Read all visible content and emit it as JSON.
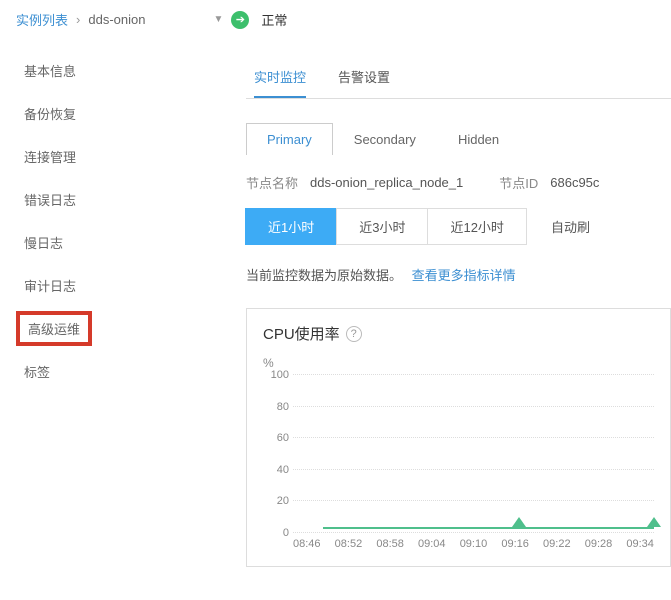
{
  "breadcrumb": {
    "list_label": "实例列表",
    "instance": "dds-onion",
    "status": "正常"
  },
  "sidebar": {
    "items": [
      {
        "label": "基本信息"
      },
      {
        "label": "备份恢复"
      },
      {
        "label": "连接管理"
      },
      {
        "label": "错误日志"
      },
      {
        "label": "慢日志"
      },
      {
        "label": "审计日志"
      },
      {
        "label": "高级运维"
      },
      {
        "label": "标签"
      }
    ]
  },
  "tabs1": [
    {
      "label": "实时监控"
    },
    {
      "label": "告警设置"
    }
  ],
  "tabs2": [
    {
      "label": "Primary"
    },
    {
      "label": "Secondary"
    },
    {
      "label": "Hidden"
    }
  ],
  "info": {
    "node_name_label": "节点名称",
    "node_name": "dds-onion_replica_node_1",
    "node_id_label": "节点ID",
    "node_id": "686c95c"
  },
  "time_buttons": [
    {
      "label": "近1小时"
    },
    {
      "label": "近3小时"
    },
    {
      "label": "近12小时"
    }
  ],
  "auto_refresh": "自动刷",
  "desc": {
    "text": "当前监控数据为原始数据。",
    "link": "查看更多指标详情"
  },
  "chart": {
    "title": "CPU使用率"
  },
  "chart_data": {
    "type": "line",
    "title": "CPU使用率",
    "ylabel": "%",
    "ylim": [
      0,
      100
    ],
    "yticks": [
      0,
      20,
      40,
      60,
      80,
      100
    ],
    "categories": [
      "08:46",
      "08:52",
      "08:58",
      "09:04",
      "09:10",
      "09:16",
      "09:22",
      "09:28",
      "09:34"
    ],
    "values": [
      3,
      3,
      3,
      3,
      3,
      3,
      3,
      3,
      3
    ],
    "markers_at": [
      "09:16",
      "09:34"
    ]
  }
}
